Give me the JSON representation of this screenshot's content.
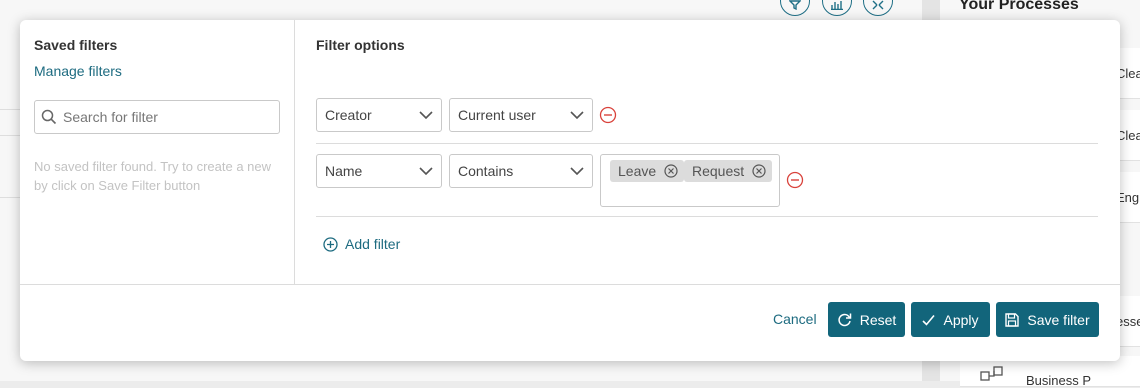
{
  "background": {
    "right_panel_title": "Your Processes",
    "right_panel_fragments": [
      "Clea",
      "Clea",
      "Engin",
      "esses",
      "Business P"
    ],
    "top_icons": [
      "filter-icon",
      "bar-chart-icon",
      "expand-icon"
    ]
  },
  "saved_filters": {
    "title": "Saved filters",
    "manage_link": "Manage filters",
    "search_placeholder": "Search for filter",
    "empty_message": "No saved filter found. Try to create a new by click on Save Filter button"
  },
  "filter_options": {
    "title": "Filter options",
    "rows": [
      {
        "field": "Creator",
        "operator": "Current user"
      },
      {
        "field": "Name",
        "operator": "Contains",
        "tags": [
          "Leave",
          "Request"
        ]
      }
    ],
    "add_filter_label": "Add filter"
  },
  "footer": {
    "cancel_label": "Cancel",
    "reset_label": "Reset",
    "apply_label": "Apply",
    "save_filter_label": "Save filter"
  },
  "colors": {
    "primary": "#12657b",
    "link": "#1d6b80",
    "remove": "#d9423b"
  }
}
